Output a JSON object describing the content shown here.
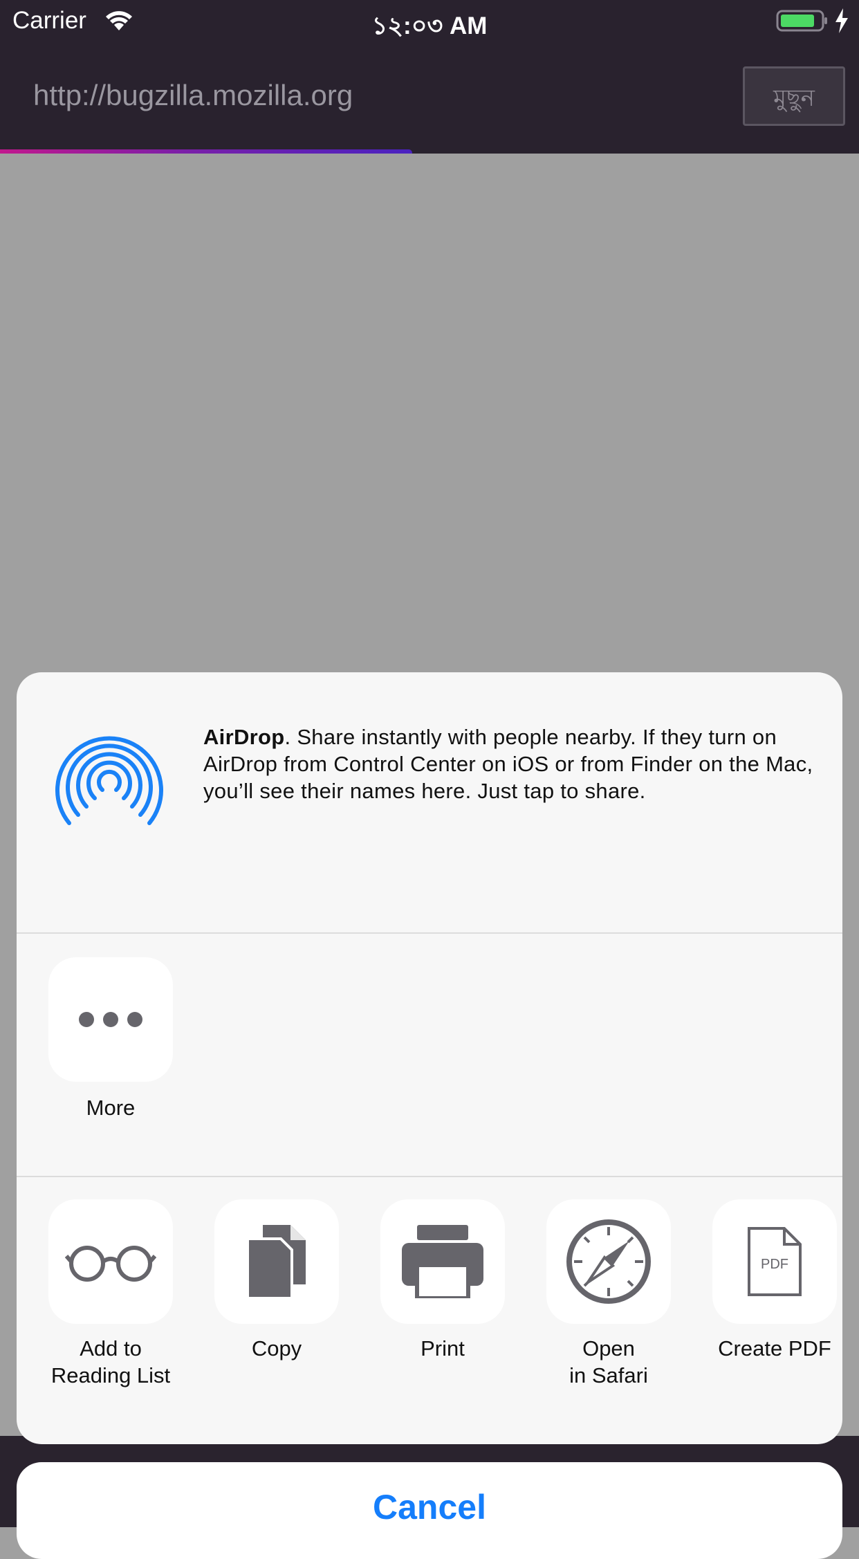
{
  "status_bar": {
    "carrier": "Carrier",
    "time": "১২:০৩ AM"
  },
  "browser": {
    "url": "http://bugzilla.mozilla.org",
    "cancel_button": "মুছুন",
    "progress": 0.48
  },
  "share_sheet": {
    "airdrop": {
      "title": "AirDrop",
      "description": ". Share instantly with people nearby. If they turn on AirDrop from Control Center on iOS or from Finder on the Mac, you’ll see their names here. Just tap to share."
    },
    "share_row": [
      {
        "label": "More",
        "icon": "more-icon"
      }
    ],
    "action_row": [
      {
        "label": "Add to\nReading List",
        "icon": "glasses-icon"
      },
      {
        "label": "Copy",
        "icon": "copy-icon"
      },
      {
        "label": "Print",
        "icon": "printer-icon"
      },
      {
        "label": "Open\nin Safari",
        "icon": "compass-icon"
      },
      {
        "label": "Create PDF",
        "icon": "pdf-icon"
      }
    ],
    "pdf_badge": "PDF",
    "cancel_label": "Cancel"
  },
  "colors": {
    "accent": "#157efb",
    "toolbar": "#29222e",
    "icon_gray": "#66656b"
  }
}
